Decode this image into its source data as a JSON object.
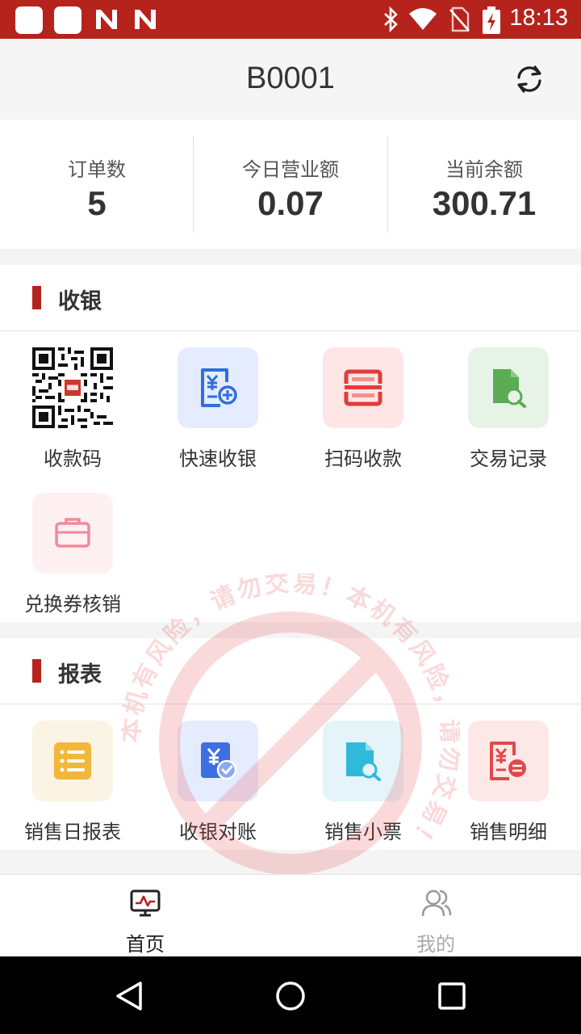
{
  "status_bar": {
    "time": "18:13",
    "icons": [
      "app-square-icon",
      "app-square-icon",
      "n-logo-icon",
      "n-logo-icon",
      "bluetooth-icon",
      "wifi-icon",
      "no-sim-icon",
      "battery-charging-icon"
    ]
  },
  "header": {
    "title": "B0001",
    "refresh_icon": "refresh-icon"
  },
  "stats": [
    {
      "label": "订单数",
      "value": "5"
    },
    {
      "label": "今日营业额",
      "value": "0.07"
    },
    {
      "label": "当前余额",
      "value": "300.71"
    }
  ],
  "cashier": {
    "title": "收银",
    "items": [
      {
        "label": "收款码",
        "icon": "qr-code-icon"
      },
      {
        "label": "快速收银",
        "icon": "quick-cashier-icon",
        "bg": "#e6ecff",
        "color": "#2f6fe0"
      },
      {
        "label": "扫码收款",
        "icon": "scan-icon",
        "bg": "#ffe6e6",
        "color": "#e53a3a"
      },
      {
        "label": "交易记录",
        "icon": "transaction-search-icon",
        "bg": "#e7f3e6",
        "color": "#5cab55"
      },
      {
        "label": "兑换券核销",
        "icon": "coupon-icon",
        "bg": "#fff0f2",
        "color": "#f2899a"
      }
    ]
  },
  "reports": {
    "title": "报表",
    "items": [
      {
        "label": "销售日报表",
        "icon": "daily-report-icon",
        "bg": "#fbf4e4",
        "color": "#f2b73a"
      },
      {
        "label": "收银对账",
        "icon": "reconcile-icon",
        "bg": "#e6ecff",
        "color": "#3d6fe0"
      },
      {
        "label": "销售小票",
        "icon": "receipt-search-icon",
        "bg": "#e4f4f8",
        "color": "#2fbadc"
      },
      {
        "label": "销售明细",
        "icon": "sales-detail-icon",
        "bg": "#fde8e8",
        "color": "#e24848"
      }
    ]
  },
  "tabs": [
    {
      "label": "首页",
      "icon": "home-monitor-icon",
      "active": true
    },
    {
      "label": "我的",
      "icon": "users-icon",
      "active": false
    }
  ],
  "watermark": {
    "text": "本机有风险，请勿交易！本机有风险，请勿交易！",
    "color": "#e8333a"
  },
  "colors": {
    "brand": "#b5231c",
    "active_tab": "#222222",
    "inactive_tab": "#aaaaaa"
  }
}
